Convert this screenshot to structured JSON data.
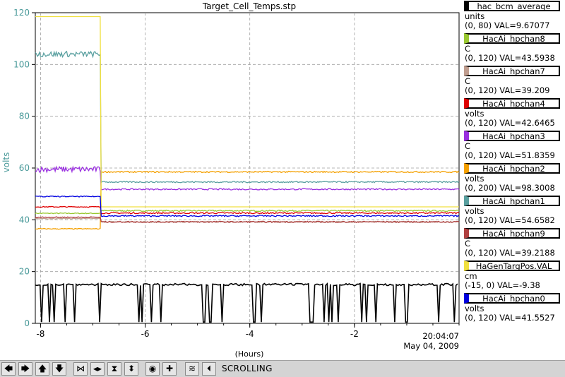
{
  "chart_data": {
    "type": "line",
    "title": "Target_Cell_Temps.stp",
    "ylabel": "volts",
    "xlabel": "(Hours)",
    "ylim": [
      0,
      120
    ],
    "xlim": [
      -8.1,
      0
    ],
    "y_ticks": [
      0,
      20,
      40,
      60,
      80,
      100,
      120
    ],
    "x_ticks": [
      "-8",
      "-6",
      "-4",
      "-2"
    ],
    "end_time": "20:04:07",
    "end_date": "May 04, 2009",
    "grid": true,
    "series": [
      {
        "name": "hac_bcm_average",
        "unit": "units",
        "range": "(0, 80) VAL=9.67077",
        "color": "#000000"
      },
      {
        "name": "HacAi_hpchan8",
        "unit": "C",
        "range": "(0, 120) VAL=43.5938",
        "color": "#9ac832",
        "before": 42.5,
        "after": 43.5
      },
      {
        "name": "HacAi_hpchan7",
        "unit": "C",
        "range": "(0, 120) VAL=39.209",
        "color": "#c09e90",
        "before": 40.5,
        "after": 39.2
      },
      {
        "name": "HacAi_hpchan4",
        "unit": "volts",
        "range": "(0, 120) VAL=42.6465",
        "color": "#e00000",
        "before": 45.0,
        "after": 42.6
      },
      {
        "name": "HacAi_hpchan3",
        "unit": "C",
        "range": "(0, 120) VAL=51.8359",
        "color": "#9a30e0",
        "before": 59.5,
        "after": 51.8
      },
      {
        "name": "HacAi_hpchan2",
        "unit": "volts",
        "range": "(0, 200) VAL=98.3008",
        "color": "#f4a000",
        "before": 36.5,
        "after": 58.5
      },
      {
        "name": "HacAi_hpchan1",
        "unit": "volts",
        "range": "(0, 120) VAL=54.6582",
        "color": "#5aa0a0",
        "before": 104,
        "after": 54.6
      },
      {
        "name": "HacAi_hpchan9",
        "unit": "C",
        "range": "(0, 120) VAL=39.2188",
        "color": "#b04040",
        "before": 41.0,
        "after": 39.2
      },
      {
        "name": "HaGenTargPos.VAL",
        "unit": "cm",
        "range": "(-15, 0) VAL=-9.38",
        "color": "#f0e040",
        "before": 118.5,
        "after": 45.0
      },
      {
        "name": "HacAi_hpchan0",
        "unit": "volts",
        "range": "(0, 120) VAL=41.5527",
        "color": "#0000e0",
        "before": 49.0,
        "after": 41.5
      }
    ],
    "step_time": -6.85
  },
  "toolbar": {
    "status": "SCROLLING",
    "buttons": [
      {
        "name": "scroll-left-button",
        "glyph": "🡄"
      },
      {
        "name": "scroll-right-button",
        "glyph": "🡆"
      },
      {
        "name": "scroll-up-button",
        "glyph": "🡅"
      },
      {
        "name": "scroll-down-button",
        "glyph": "🡇"
      },
      {
        "name": "zoom-in-x-button",
        "glyph": "⋈"
      },
      {
        "name": "zoom-out-x-button",
        "glyph": "◂▸"
      },
      {
        "name": "zoom-in-y-button",
        "glyph": "⧗"
      },
      {
        "name": "zoom-out-y-button",
        "glyph": "⬍"
      },
      {
        "name": "stop-button",
        "glyph": "◉"
      },
      {
        "name": "add-button",
        "glyph": "✚"
      },
      {
        "name": "autoscale-button",
        "glyph": "≋"
      },
      {
        "name": "resume-scroll-button",
        "glyph": "⏴"
      }
    ]
  }
}
